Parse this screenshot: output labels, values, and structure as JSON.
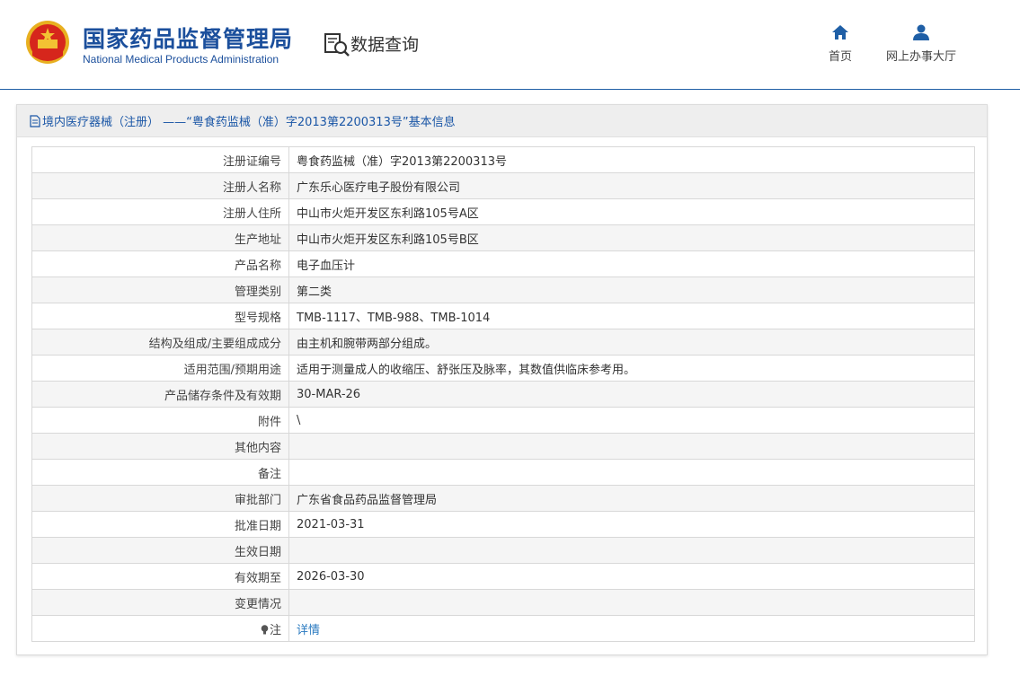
{
  "header": {
    "org_name_cn": "国家药品监督管理局",
    "org_name_en": "National Medical Products Administration",
    "section_title": "数据查询",
    "nav": [
      {
        "label": "首页",
        "icon": "home-icon"
      },
      {
        "label": "网上办事大厅",
        "icon": "user-icon"
      }
    ]
  },
  "panel": {
    "title": "境内医疗器械（注册） ——“粤食药监械（准）字2013第2200313号”基本信息"
  },
  "rows": [
    {
      "label": "注册证编号",
      "value": "粤食药监械（准）字2013第2200313号"
    },
    {
      "label": "注册人名称",
      "value": "广东乐心医疗电子股份有限公司"
    },
    {
      "label": "注册人住所",
      "value": "中山市火炬开发区东利路105号A区"
    },
    {
      "label": "生产地址",
      "value": "中山市火炬开发区东利路105号B区"
    },
    {
      "label": "产品名称",
      "value": "电子血压计"
    },
    {
      "label": "管理类别",
      "value": "第二类"
    },
    {
      "label": "型号规格",
      "value": "TMB-1117、TMB-988、TMB-1014"
    },
    {
      "label": "结构及组成/主要组成成分",
      "value": "由主机和腕带两部分组成。"
    },
    {
      "label": "适用范围/预期用途",
      "value": "适用于测量成人的收缩压、舒张压及脉率，其数值供临床参考用。"
    },
    {
      "label": "产品储存条件及有效期",
      "value": "30-MAR-26"
    },
    {
      "label": "附件",
      "value": "\\"
    },
    {
      "label": "其他内容",
      "value": ""
    },
    {
      "label": "备注",
      "value": ""
    },
    {
      "label": "审批部门",
      "value": "广东省食品药品监督管理局"
    },
    {
      "label": "批准日期",
      "value": "2021-03-31"
    },
    {
      "label": "生效日期",
      "value": ""
    },
    {
      "label": "有效期至",
      "value": "2026-03-30"
    },
    {
      "label": "变更情况",
      "value": ""
    }
  ],
  "note_row": {
    "label": "注",
    "link": "详情",
    "icon": "lightbulb-icon"
  },
  "colors": {
    "brand_blue": "#1b4f9c",
    "link_blue": "#2a7ac0",
    "alt_row": "#f5f5f5"
  }
}
